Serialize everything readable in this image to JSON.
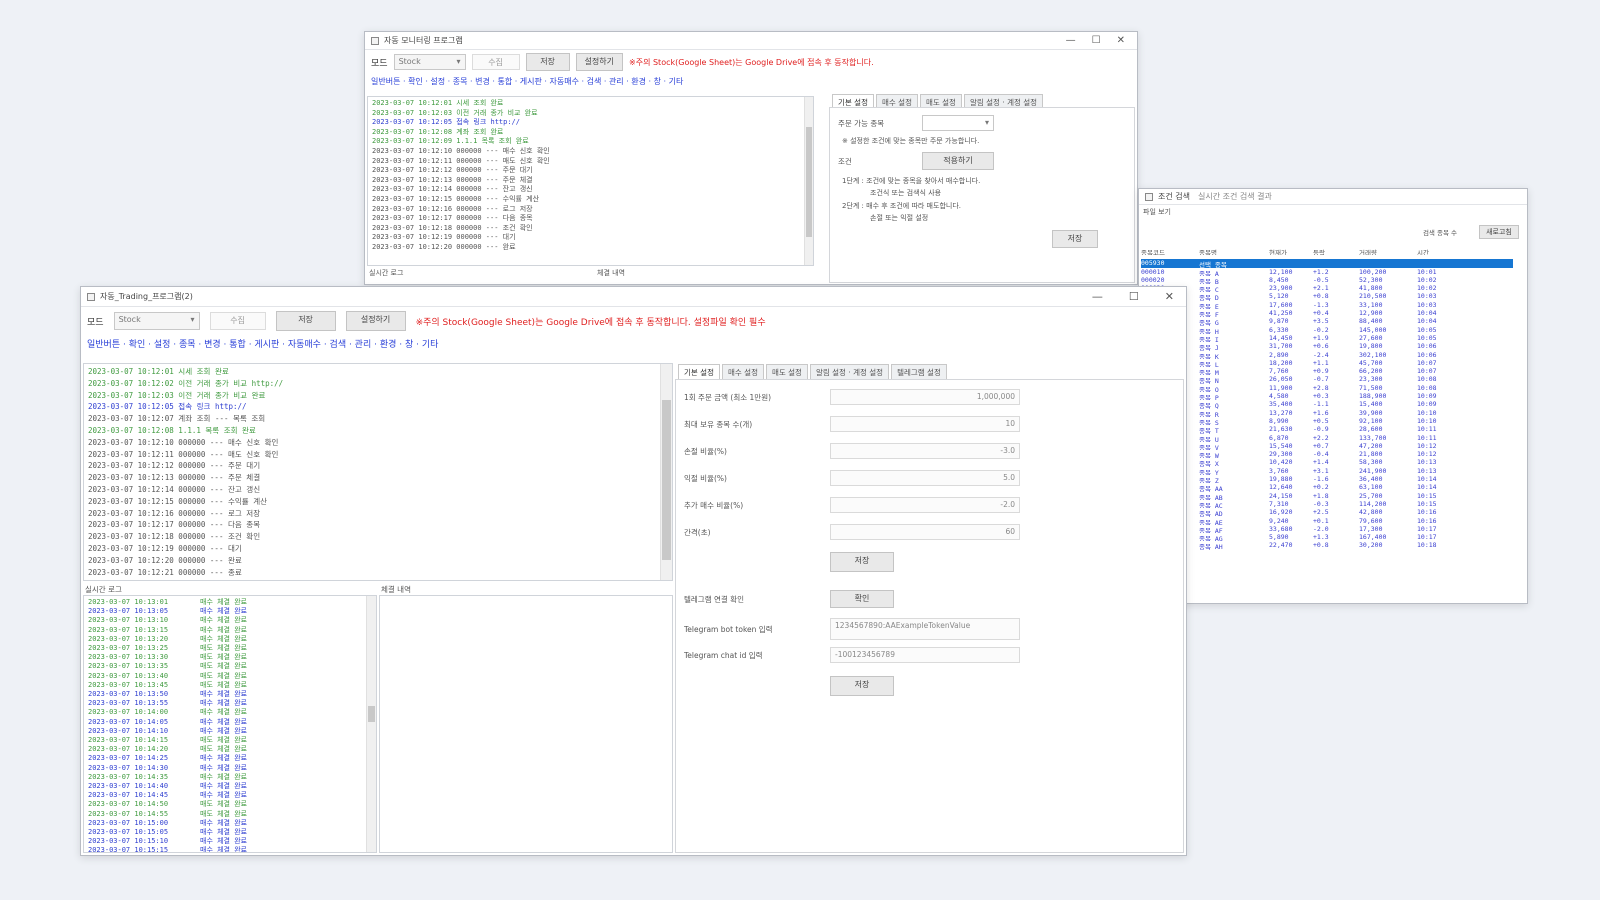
{
  "colors": {
    "accent_red": "#e02020",
    "link_blue": "#2a40d8",
    "log_green": "#3f9a3f",
    "log_blue": "#2f3fd0",
    "selection": "#1676d2"
  },
  "icons": {
    "minimize": "minimize-icon",
    "maximize": "maximize-icon",
    "close": "close-icon"
  },
  "back_window": {
    "title": "자동 모니터링 프로그램",
    "win_buttons": {
      "min": "—",
      "max": "☐",
      "close": "✕"
    },
    "toolbar": {
      "label": "모드",
      "select_value": "Stock",
      "input_value": "수집",
      "btn1": "저장",
      "btn2": "설정하기",
      "note": "※주의 Stock(Google Sheet)는 Google Drive에 접속 후 동작합니다."
    },
    "links": "일반버튼 · 확인 · 설정 · 종목 · 변경 · 통합 · 게시판 · 자동매수 · 검색 · 관리 · 환경 · 창 · 기타",
    "log": [
      {
        "t": "2023-03-07 10:12:01  시세 조회 완료",
        "c": "green"
      },
      {
        "t": "2023-03-07 10:12:03  이전 거래 종가 비교 완료",
        "c": "green"
      },
      {
        "t": "2023-03-07 10:12:05  접속 링크 http://",
        "c": "blue"
      },
      {
        "t": "2023-03-07 10:12:08  계좌 조회 완료",
        "c": "green"
      },
      {
        "t": "2023-03-07 10:12:09  1.1.1 목록 조회 완료",
        "c": "green"
      },
      {
        "t": "2023-03-07 10:12:10  000000 --- 매수 신호 확인",
        "c": "gray"
      },
      {
        "t": "2023-03-07 10:12:11  000000 --- 매도 신호 확인",
        "c": "gray"
      },
      {
        "t": "2023-03-07 10:12:12  000000 --- 주문 대기",
        "c": "gray"
      },
      {
        "t": "2023-03-07 10:12:13  000000 --- 주문 체결",
        "c": "gray"
      },
      {
        "t": "2023-03-07 10:12:14  000000 --- 잔고 갱신",
        "c": "gray"
      },
      {
        "t": "2023-03-07 10:12:15  000000 --- 수익률 계산",
        "c": "gray"
      },
      {
        "t": "2023-03-07 10:12:16  000000 --- 로그 저장",
        "c": "gray"
      },
      {
        "t": "2023-03-07 10:12:17  000000 --- 다음 종목",
        "c": "gray"
      },
      {
        "t": "2023-03-07 10:12:18  000000 --- 조건 확인",
        "c": "gray"
      },
      {
        "t": "2023-03-07 10:12:19  000000 --- 대기",
        "c": "gray"
      },
      {
        "t": "2023-03-07 10:12:20  000000 --- 완료",
        "c": "gray"
      }
    ],
    "bottom_labels": {
      "left": "실시간 로그",
      "right": "체결 내역"
    },
    "tabs": [
      "기본 설정",
      "매수 설정",
      "매도 설정",
      "알림 설정 · 계정 설정"
    ],
    "form": {
      "row1_label": "주문 가능 종목",
      "row2_text": "※ 설정한 조건에 맞는 종목만 주문 가능합니다.",
      "row3_label": "조건",
      "row3_btn": "적용하기",
      "desc1": "1단계  : 조건에 맞는 종목을 찾아서 매수합니다.",
      "desc1b": "조건식 또는 검색식 사용",
      "desc2": "2단계  : 매수 후 조건에 따라 매도합니다.",
      "desc2b": "손절 또는 익절 설정",
      "save_btn": "저장"
    }
  },
  "right_window": {
    "title": "조건 검색",
    "subtitle": "실시간 조건 검색 결과",
    "menu": "파일  보기",
    "count_label": "검색 종목 수",
    "refresh_btn": "새로고침",
    "headers": [
      "종목코드",
      "종목명",
      "현재가",
      "등락",
      "거래량",
      "시간"
    ],
    "selected_row": [
      "005930",
      "선택 종목",
      "",
      "",
      "",
      ""
    ],
    "rows": [
      [
        "000010",
        "종목 A",
        "12,100",
        "+1.2",
        "100,200",
        "10:01"
      ],
      [
        "000020",
        "종목 B",
        "8,450",
        "-0.5",
        "52,300",
        "10:02"
      ],
      [
        "000030",
        "종목 C",
        "23,900",
        "+2.1",
        "41,800",
        "10:02"
      ],
      [
        "000040",
        "종목 D",
        "5,120",
        "+0.8",
        "210,500",
        "10:03"
      ],
      [
        "000050",
        "종목 E",
        "17,600",
        "-1.3",
        "33,100",
        "10:03"
      ],
      [
        "000060",
        "종목 F",
        "41,250",
        "+0.4",
        "12,900",
        "10:04"
      ],
      [
        "000070",
        "종목 G",
        "9,870",
        "+3.5",
        "88,400",
        "10:04"
      ],
      [
        "000080",
        "종목 H",
        "6,330",
        "-0.2",
        "145,000",
        "10:05"
      ],
      [
        "000090",
        "종목 I",
        "14,450",
        "+1.9",
        "27,600",
        "10:05"
      ],
      [
        "000100",
        "종목 J",
        "31,700",
        "+0.6",
        "19,800",
        "10:06"
      ],
      [
        "000110",
        "종목 K",
        "2,890",
        "-2.4",
        "302,100",
        "10:06"
      ],
      [
        "000120",
        "종목 L",
        "18,200",
        "+1.1",
        "45,700",
        "10:07"
      ],
      [
        "000130",
        "종목 M",
        "7,760",
        "+0.9",
        "66,200",
        "10:07"
      ],
      [
        "000140",
        "종목 N",
        "26,050",
        "-0.7",
        "23,300",
        "10:08"
      ],
      [
        "000150",
        "종목 O",
        "11,900",
        "+2.8",
        "71,500",
        "10:08"
      ],
      [
        "000160",
        "종목 P",
        "4,580",
        "+0.3",
        "188,900",
        "10:09"
      ],
      [
        "000170",
        "종목 Q",
        "35,400",
        "-1.1",
        "15,400",
        "10:09"
      ],
      [
        "000180",
        "종목 R",
        "13,270",
        "+1.6",
        "39,900",
        "10:10"
      ],
      [
        "000190",
        "종목 S",
        "8,990",
        "+0.5",
        "92,100",
        "10:10"
      ],
      [
        "000200",
        "종목 T",
        "21,630",
        "-0.9",
        "28,600",
        "10:11"
      ],
      [
        "000210",
        "종목 U",
        "6,870",
        "+2.2",
        "133,700",
        "10:11"
      ],
      [
        "000220",
        "종목 V",
        "15,540",
        "+0.7",
        "47,200",
        "10:12"
      ],
      [
        "000230",
        "종목 W",
        "29,300",
        "-0.4",
        "21,800",
        "10:12"
      ],
      [
        "000240",
        "종목 X",
        "10,420",
        "+1.4",
        "58,300",
        "10:13"
      ],
      [
        "000250",
        "종목 Y",
        "3,760",
        "+3.1",
        "241,900",
        "10:13"
      ],
      [
        "000260",
        "종목 Z",
        "19,880",
        "-1.6",
        "36,400",
        "10:14"
      ],
      [
        "000270",
        "종목 AA",
        "12,640",
        "+0.2",
        "63,100",
        "10:14"
      ],
      [
        "000280",
        "종목 AB",
        "24,150",
        "+1.8",
        "25,700",
        "10:15"
      ],
      [
        "000290",
        "종목 AC",
        "7,310",
        "-0.3",
        "114,200",
        "10:15"
      ],
      [
        "000300",
        "종목 AD",
        "16,920",
        "+2.5",
        "42,800",
        "10:16"
      ],
      [
        "000310",
        "종목 AE",
        "9,240",
        "+0.1",
        "79,600",
        "10:16"
      ],
      [
        "000320",
        "종목 AF",
        "33,680",
        "-2.0",
        "17,300",
        "10:17"
      ],
      [
        "000330",
        "종목 AG",
        "5,890",
        "+1.3",
        "167,400",
        "10:17"
      ],
      [
        "000340",
        "종목 AH",
        "22,470",
        "+0.8",
        "30,200",
        "10:18"
      ]
    ]
  },
  "front_window": {
    "title": "자동_Trading_프로그램(2)",
    "win_buttons": {
      "min": "—",
      "max": "☐",
      "close": "✕"
    },
    "toolbar": {
      "label": "모드",
      "select_value": "Stock",
      "input_value": "수집",
      "btn1": "저장",
      "btn2": "설정하기",
      "note": "※주의 Stock(Google Sheet)는 Google Drive에 접속 후 동작합니다. 설정파일 확인 필수"
    },
    "links": "일반버튼 · 확인 · 설정 · 종목 · 변경 · 통합 · 게시판 · 자동매수 · 검색 · 관리 · 환경 · 창 · 기타",
    "log": [
      {
        "t": "2023-03-07 10:12:01  시세 조회 완료",
        "c": "green"
      },
      {
        "t": "2023-03-07 10:12:02  이전 거래 종가 비교 http://",
        "c": "green"
      },
      {
        "t": "2023-03-07 10:12:03  이전 거래 종가 비교 완료",
        "c": "green"
      },
      {
        "t": "2023-03-07 10:12:05  접속 링크 http://",
        "c": "blue"
      },
      {
        "t": "2023-03-07 10:12:07  계좌 조회 --- 목록 조회",
        "c": "gray"
      },
      {
        "t": "2023-03-07 10:12:08  1.1.1 목록 조회 완료",
        "c": "green"
      },
      {
        "t": "2023-03-07 10:12:10  000000 --- 매수 신호 확인",
        "c": "gray"
      },
      {
        "t": "2023-03-07 10:12:11  000000 --- 매도 신호 확인",
        "c": "gray"
      },
      {
        "t": "2023-03-07 10:12:12  000000 --- 주문 대기",
        "c": "gray"
      },
      {
        "t": "2023-03-07 10:12:13  000000 --- 주문 체결",
        "c": "gray"
      },
      {
        "t": "2023-03-07 10:12:14  000000 --- 잔고 갱신",
        "c": "gray"
      },
      {
        "t": "2023-03-07 10:12:15  000000 --- 수익률 계산",
        "c": "gray"
      },
      {
        "t": "2023-03-07 10:12:16  000000 --- 로그 저장",
        "c": "gray"
      },
      {
        "t": "2023-03-07 10:12:17  000000 --- 다음 종목",
        "c": "gray"
      },
      {
        "t": "2023-03-07 10:12:18  000000 --- 조건 확인",
        "c": "gray"
      },
      {
        "t": "2023-03-07 10:12:19  000000 --- 대기",
        "c": "gray"
      },
      {
        "t": "2023-03-07 10:12:20  000000 --- 완료",
        "c": "gray"
      },
      {
        "t": "2023-03-07 10:12:21  000000 --- 종료",
        "c": "gray"
      }
    ],
    "bottom_labels": {
      "left": "실시간 로그",
      "right": "체결 내역"
    },
    "mini_log": [
      {
        "a": "2023-03-07 10:13:01",
        "b": "매수 체결 완료",
        "c": "green"
      },
      {
        "a": "2023-03-07 10:13:05",
        "b": "매수 체결 완료",
        "c": "blue"
      },
      {
        "a": "2023-03-07 10:13:10",
        "b": "매수 체결 완료",
        "c": "green"
      },
      {
        "a": "2023-03-07 10:13:15",
        "b": "매수 체결 완료",
        "c": "green"
      },
      {
        "a": "2023-03-07 10:13:20",
        "b": "매수 체결 완료",
        "c": "green"
      },
      {
        "a": "2023-03-07 10:13:25",
        "b": "매도 체결 완료",
        "c": "green"
      },
      {
        "a": "2023-03-07 10:13:30",
        "b": "매도 체결 완료",
        "c": "green"
      },
      {
        "a": "2023-03-07 10:13:35",
        "b": "매도 체결 완료",
        "c": "green"
      },
      {
        "a": "2023-03-07 10:13:40",
        "b": "매도 체결 완료",
        "c": "green"
      },
      {
        "a": "2023-03-07 10:13:45",
        "b": "매도 체결 완료",
        "c": "green"
      },
      {
        "a": "2023-03-07 10:13:50",
        "b": "매수 체결 완료",
        "c": "blue"
      },
      {
        "a": "2023-03-07 10:13:55",
        "b": "매수 체결 완료",
        "c": "blue"
      },
      {
        "a": "2023-03-07 10:14:00",
        "b": "매수 체결 완료",
        "c": "green"
      },
      {
        "a": "2023-03-07 10:14:05",
        "b": "매수 체결 완료",
        "c": "blue"
      },
      {
        "a": "2023-03-07 10:14:10",
        "b": "매수 체결 완료",
        "c": "blue"
      },
      {
        "a": "2023-03-07 10:14:15",
        "b": "매도 체결 완료",
        "c": "green"
      },
      {
        "a": "2023-03-07 10:14:20",
        "b": "매도 체결 완료",
        "c": "green"
      },
      {
        "a": "2023-03-07 10:14:25",
        "b": "매수 체결 완료",
        "c": "blue"
      },
      {
        "a": "2023-03-07 10:14:30",
        "b": "매수 체결 완료",
        "c": "blue"
      },
      {
        "a": "2023-03-07 10:14:35",
        "b": "매수 체결 완료",
        "c": "green"
      },
      {
        "a": "2023-03-07 10:14:40",
        "b": "매수 체결 완료",
        "c": "blue"
      },
      {
        "a": "2023-03-07 10:14:45",
        "b": "매수 체결 완료",
        "c": "blue"
      },
      {
        "a": "2023-03-07 10:14:50",
        "b": "매도 체결 완료",
        "c": "green"
      },
      {
        "a": "2023-03-07 10:14:55",
        "b": "매도 체결 완료",
        "c": "green"
      },
      {
        "a": "2023-03-07 10:15:00",
        "b": "매수 체결 완료",
        "c": "blue"
      },
      {
        "a": "2023-03-07 10:15:05",
        "b": "매수 체결 완료",
        "c": "blue"
      },
      {
        "a": "2023-03-07 10:15:10",
        "b": "매수 체결 완료",
        "c": "blue"
      },
      {
        "a": "2023-03-07 10:15:15",
        "b": "매수 체결 완료",
        "c": "blue"
      }
    ],
    "tabs": [
      "기본 설정",
      "매수 설정",
      "매도 설정",
      "알림 설정 · 계정 설정",
      "텔레그램 설정"
    ],
    "form": {
      "fields": [
        {
          "label": "1회 주문 금액 (최소 1만원)",
          "value": "1,000,000"
        },
        {
          "label": "최대 보유 종목 수(개)",
          "value": "10"
        },
        {
          "label": "손절 비율(%)",
          "value": "-3.0"
        },
        {
          "label": "익절 비율(%)",
          "value": "5.0"
        },
        {
          "label": "추가 매수 비율(%)",
          "value": "-2.0"
        },
        {
          "label": "간격(초)",
          "value": "60"
        }
      ],
      "save_btn": "저장",
      "telegram_label": "텔레그램 연결 확인",
      "telegram_btn": "확인",
      "token_label": "Telegram bot token 입력",
      "token_value": "1234567890:AAExampleTokenValue",
      "chat_label": "Telegram chat id 입력",
      "chat_value": "-100123456789",
      "save_btn2": "저장"
    }
  }
}
